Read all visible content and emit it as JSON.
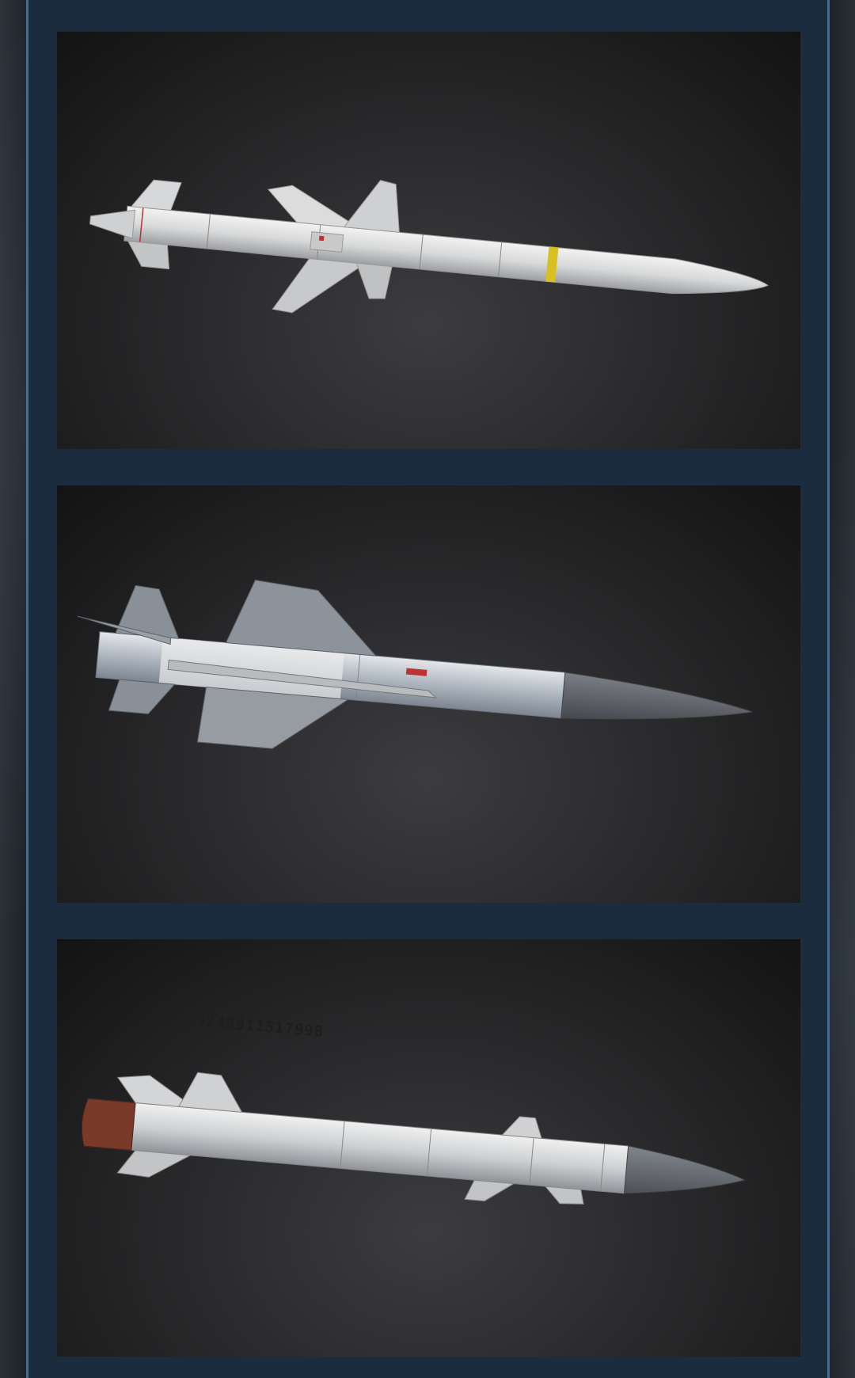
{
  "gallery": {
    "items": [
      {
        "kind": "missile-render",
        "livery": "light-grey",
        "band_color": "#d8c020"
      },
      {
        "kind": "missile-render",
        "livery": "blue-grey",
        "nose_color": "#5b5f66"
      },
      {
        "kind": "missile-render",
        "livery": "silver",
        "nose_color": "#5d6168",
        "serial": "3248911517998"
      }
    ]
  },
  "colors": {
    "panel": "#1a2c3d",
    "panel_border": "#3a6ea5",
    "card_bg": "#2a2a2c"
  }
}
